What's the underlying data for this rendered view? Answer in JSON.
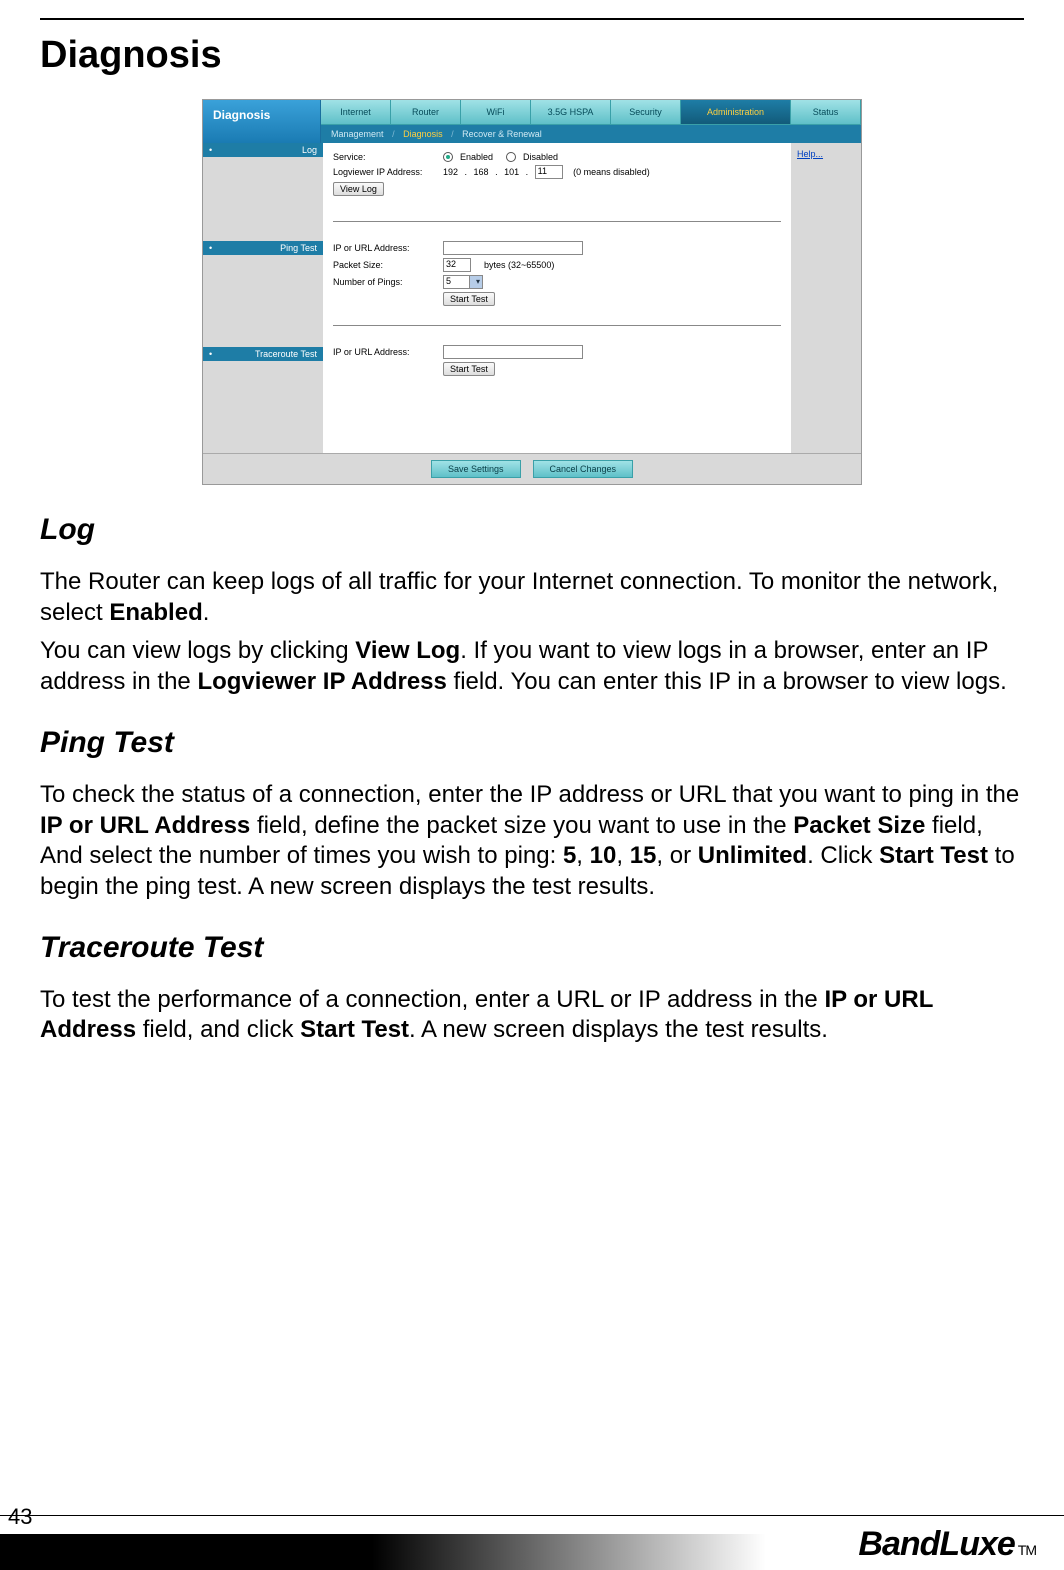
{
  "page": {
    "title": "Diagnosis",
    "number": "43"
  },
  "brand": {
    "name": "BandLuxe",
    "tm": "TM"
  },
  "screenshot": {
    "title": "Diagnosis",
    "mainTabs": [
      "Internet",
      "Router",
      "WiFi",
      "3.5G HSPA",
      "Security",
      "Administration",
      "Status"
    ],
    "subTabs": {
      "mgmt": "Management",
      "diag": "Diagnosis",
      "rr": "Recover & Renewal",
      "sep": "/"
    },
    "sideHelp": "Help...",
    "sections": {
      "log": {
        "tag": "Log",
        "serviceLabel": "Service:",
        "enabled": "Enabled",
        "disabled": "Disabled",
        "ipLabel": "Logviewer IP Address:",
        "ip1": "192",
        "ip2": "168",
        "ip3": "101",
        "ip4": "11",
        "ipNote": "(0 means disabled)",
        "viewLogBtn": "View Log"
      },
      "ping": {
        "tag": "Ping Test",
        "addrLabel": "IP or URL Address:",
        "sizeLabel": "Packet Size:",
        "sizeVal": "32",
        "sizeHint": "bytes (32~65500)",
        "numLabel": "Number of Pings:",
        "numVal": "5",
        "startBtn": "Start Test"
      },
      "trace": {
        "tag": "Traceroute Test",
        "addrLabel": "IP or URL Address:",
        "startBtn": "Start Test"
      }
    },
    "footer": {
      "save": "Save Settings",
      "cancel": "Cancel Changes"
    }
  },
  "text": {
    "logH": "Log",
    "logP1a": "The Router can keep logs of all traffic for your Internet connection. To monitor the network, select ",
    "logP1b": "Enabled",
    "logP1c": ".",
    "logP2a": "You can view logs by clicking ",
    "logP2b": "View Log",
    "logP2c": ". If you want to view logs in a browser, enter an IP address in the ",
    "logP2d": "Logviewer IP Address",
    "logP2e": " field. You can enter this IP in a browser to view logs.",
    "pingH": "Ping Test",
    "pingPa": "To check the status of a connection, enter the IP address or URL that you want to ping in the ",
    "pingPb": "IP or URL Address",
    "pingPc": " field, define the packet size you want to use in the ",
    "pingPd": "Packet Size",
    "pingPe": " field, And select the number of times you wish to ping: ",
    "pingPf": "5",
    "pingPg": ", ",
    "pingPh": "10",
    "pingPi": ", ",
    "pingPj": "15",
    "pingPk": ", or ",
    "pingPl": "Unlimited",
    "pingPm": ". Click ",
    "pingPn": "Start Test",
    "pingPo": " to begin the ping test. A new screen displays the test results.",
    "traceH": "Traceroute Test",
    "tracePa": "To test the performance of a connection, enter a URL or IP address in the ",
    "tracePb": "IP or URL Address",
    "tracePc": " field, and click ",
    "tracePd": "Start Test",
    "tracePe": ". A new screen displays the test results."
  }
}
